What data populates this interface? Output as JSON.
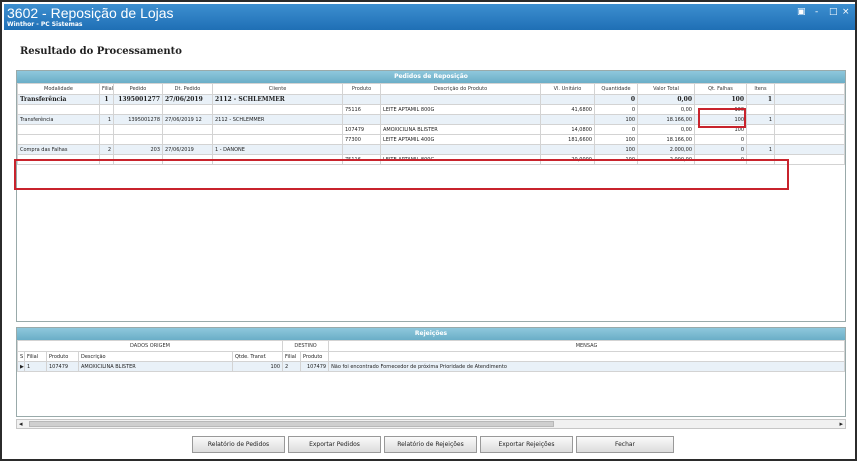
{
  "window": {
    "title": "3602 - Reposição de Lojas",
    "subtitle": "Winthor - PC Sistemas",
    "controls": [
      "▣",
      "-",
      "□",
      "×"
    ]
  },
  "page": {
    "heading": "Resultado do Processamento"
  },
  "pedidos": {
    "title": "Pedidos de Reposição",
    "columns": [
      "Modalidade",
      "Filial",
      "Pedido",
      "Dt. Pedido",
      "Cliente",
      "Produto",
      "Descrição do Produto",
      "Vl. Unitário",
      "Quantidade",
      "Valor Total",
      "Qt. Falhas",
      "Itens"
    ],
    "rows": [
      {
        "type": "parent",
        "cells": [
          "Transferência",
          "1",
          "1395001277",
          "27/06/2019",
          "2112 - SCHLEMMER",
          "",
          "",
          "",
          "0",
          "0,00",
          "100",
          "1"
        ]
      },
      {
        "type": "child",
        "cells": [
          "",
          "",
          "",
          "",
          "",
          "75116",
          "LEITE APTAMIL 800G",
          "41,6800",
          "0",
          "0,00",
          "100",
          ""
        ]
      },
      {
        "type": "row",
        "cells": [
          "Transferência",
          "1",
          "1395001278",
          "27/06/2019 12",
          "2112 - SCHLEMMER",
          "",
          "",
          "",
          "100",
          "18.166,00",
          "100",
          "1"
        ]
      },
      {
        "type": "child",
        "cells": [
          "",
          "",
          "",
          "",
          "",
          "107479",
          "AMOXICILINA BLISTER",
          "14,0800",
          "0",
          "0,00",
          "100",
          ""
        ]
      },
      {
        "type": "child",
        "cells": [
          "",
          "",
          "",
          "",
          "",
          "77300",
          "LEITE APTAMIL 400G",
          "181,6600",
          "100",
          "18.166,00",
          "0",
          ""
        ]
      },
      {
        "type": "row",
        "cells": [
          "Compra das Falhas",
          "2",
          "203",
          "27/06/2019",
          "1 - DANONE",
          "",
          "",
          "",
          "100",
          "2.000,00",
          "0",
          "1"
        ]
      },
      {
        "type": "child",
        "cells": [
          "",
          "",
          "",
          "",
          "",
          "75116",
          "LEITE APTAMIL 800G",
          "20,0000",
          "100",
          "2.000,00",
          "0",
          ""
        ]
      }
    ]
  },
  "rejeicoes": {
    "title": "Rejeições",
    "group_origem": "DADOS ORIGEM",
    "group_destino": "DESTINO",
    "group_mensagem": "MENSAG",
    "columns": [
      "S",
      "Filial",
      "Produto",
      "Descrição",
      "Qtde. Transf.",
      "Filial",
      "Produto",
      ""
    ],
    "rows": [
      {
        "cells": [
          "▶",
          "1",
          "107479",
          "AMOXICILINA BLISTER",
          "100",
          "2",
          "107479",
          "Não foi encontrado Fornecedor de próxima Prioridade de Atendimento"
        ]
      }
    ]
  },
  "scrollbar": {
    "left": "◂",
    "right": "▸"
  },
  "buttons": {
    "relatorio_pedidos": "Relatório de Pedidos",
    "exportar_pedidos": "Exportar Pedidos",
    "relatorio_rejeicoes": "Relatório de Rejeições",
    "exportar_rejeicoes": "Exportar Rejeições",
    "fechar": "Fechar"
  },
  "colors": {
    "highlight": "#c8232c",
    "panel_header": "#7bbad0",
    "titlebar": "#2a7bc2"
  }
}
